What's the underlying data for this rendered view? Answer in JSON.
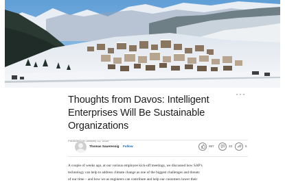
{
  "article": {
    "title_lines": [
      "Thoughts from Davos: Intelligent",
      "Enterprises Will Be Sustainable",
      "Organizations"
    ],
    "published": "Published on January 21, 2020",
    "author": "Thomas Saueressig",
    "follow_label": "Follow",
    "more_label": "···",
    "stats": {
      "likes": "997",
      "comments": "33",
      "shares": "6"
    },
    "body_lines": [
      "A couple of weeks ago, at our various employee kick-off meetings, we discussed how SAP's",
      "technology can help to address climate change as one of the biggest challenges and threats",
      "of our time – and how we as engineers can contribute and help our customers lower their"
    ]
  },
  "icons": {
    "likes": "like-icon",
    "comments": "comment-icon",
    "shares": "share-icon",
    "more": "more-options-icon"
  }
}
